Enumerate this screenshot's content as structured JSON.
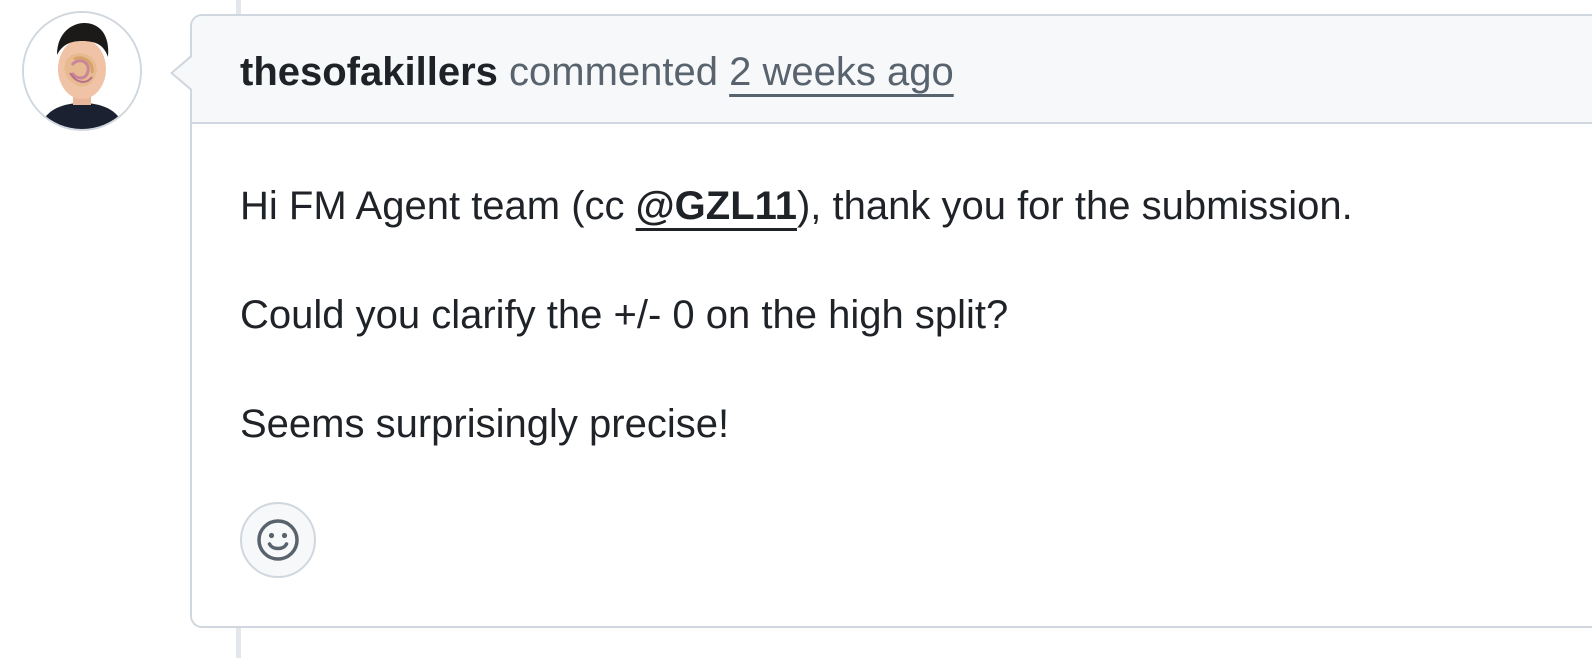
{
  "comment": {
    "author": "thesofakillers",
    "action": "commented",
    "timestamp": "2 weeks ago",
    "body": {
      "line1_before": "Hi FM Agent team (cc ",
      "line1_mention": "@GZL11",
      "line1_after": "), thank you for the submission.",
      "line2": "Could you clarify the +/- 0 on the high split?",
      "line3": "Seems surprisingly precise!"
    },
    "reaction_icon": "smiley-icon",
    "avatar_icon": "user-avatar"
  },
  "colors": {
    "border": "#d0d7de",
    "header_bg": "#f6f8fa",
    "muted_text": "#59636e",
    "text": "#1f2328"
  }
}
